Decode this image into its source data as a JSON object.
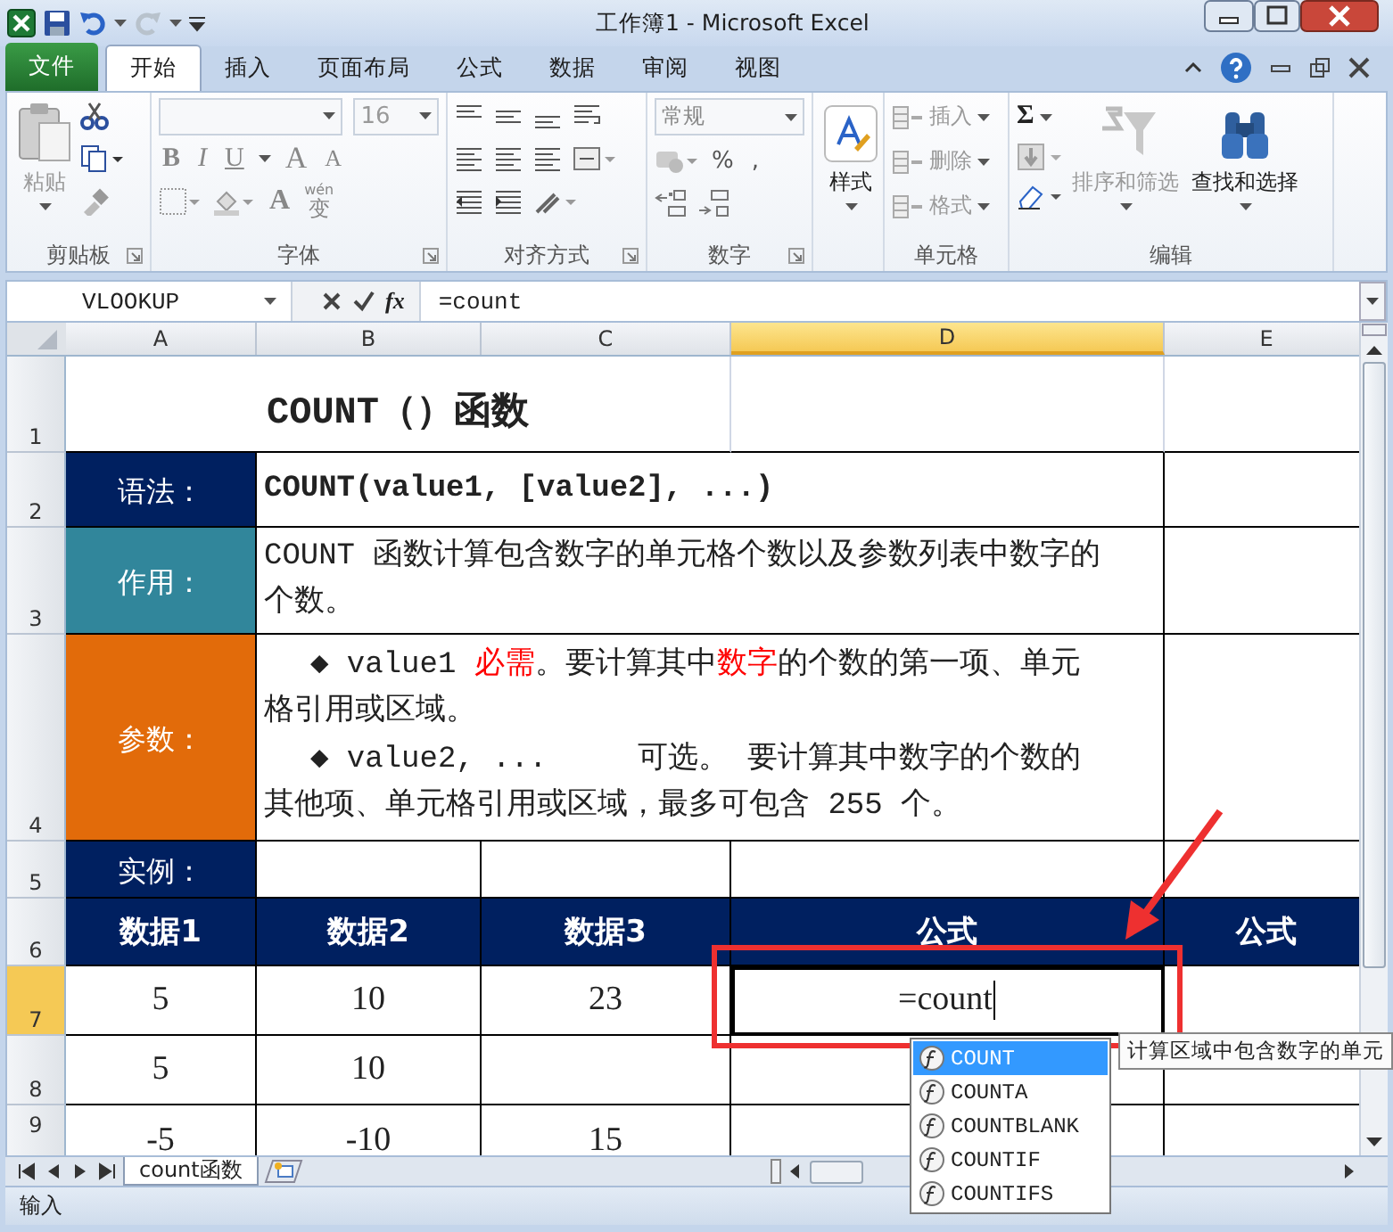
{
  "window": {
    "title": "工作簿1 - Microsoft Excel"
  },
  "ribbon_tabs": [
    {
      "label": "文件",
      "kind": "file",
      "selected": false
    },
    {
      "label": "开始",
      "kind": "tab",
      "selected": true
    },
    {
      "label": "插入",
      "kind": "tab",
      "selected": false
    },
    {
      "label": "页面布局",
      "kind": "tab",
      "selected": false
    },
    {
      "label": "公式",
      "kind": "tab",
      "selected": false
    },
    {
      "label": "数据",
      "kind": "tab",
      "selected": false
    },
    {
      "label": "审阅",
      "kind": "tab",
      "selected": false
    },
    {
      "label": "视图",
      "kind": "tab",
      "selected": false
    }
  ],
  "ribbon_groups": [
    {
      "kind": "clipboard",
      "label": "剪贴板",
      "launcher": true,
      "paste": {
        "label": "粘贴",
        "disabled": true
      }
    },
    {
      "kind": "font",
      "label": "字体",
      "launcher": true,
      "font_size": "16",
      "style_buttons": [
        "B",
        "I",
        "U"
      ],
      "size_buttons": [
        "A",
        "A"
      ],
      "font_color": "A",
      "phonetic": {
        "top": "wén",
        "main": "变"
      }
    },
    {
      "kind": "alignment",
      "label": "对齐方式",
      "launcher": true
    },
    {
      "kind": "number",
      "label": "数字",
      "launcher": true,
      "format": "常规",
      "symbols": [
        "%",
        ","
      ]
    },
    {
      "kind": "styles",
      "launcher": false,
      "button": "样式"
    },
    {
      "kind": "cells",
      "label": "单元格",
      "launcher": false,
      "buttons": [
        {
          "label": "插入",
          "disabled": true
        },
        {
          "label": "删除",
          "disabled": true
        },
        {
          "label": "格式",
          "disabled": true
        }
      ]
    },
    {
      "kind": "editing",
      "label": "编辑",
      "launcher": false,
      "sum": "Σ",
      "buttons": [
        {
          "label": "排序和筛选",
          "disabled": true
        },
        {
          "label": "查找和选择",
          "disabled": false
        }
      ]
    }
  ],
  "formula_bar": {
    "name_box": "VLOOKUP",
    "function_button": "fx",
    "value": "=count"
  },
  "columns": [
    {
      "label": "A",
      "selected": false
    },
    {
      "label": "B",
      "selected": false
    },
    {
      "label": "C",
      "selected": false
    },
    {
      "label": "D",
      "selected": true
    },
    {
      "label": "E",
      "selected": false
    }
  ],
  "rows": [
    {
      "header": "1",
      "selected": false,
      "cells": [
        {
          "kind": "title",
          "text": "COUNT（）函数"
        },
        {
          "kind": "plain",
          "text": ""
        },
        {
          "kind": "plain",
          "text": ""
        }
      ]
    },
    {
      "header": "2",
      "selected": false,
      "cells": [
        {
          "kind": "label",
          "text": "语法：",
          "color": "#002060"
        },
        {
          "kind": "body",
          "text": "COUNT(value1, [value2], ...)",
          "bold": true
        },
        {
          "kind": "plain",
          "text": ""
        }
      ]
    },
    {
      "header": "3",
      "selected": false,
      "cells": [
        {
          "kind": "label",
          "text": "作用：",
          "color": "#31869b"
        },
        {
          "kind": "body",
          "text": "COUNT 函数计算包含数字的单元格个数以及参数列表中数字的个数。",
          "bold": false
        },
        {
          "kind": "plain",
          "text": ""
        }
      ]
    },
    {
      "header": "4",
      "selected": false,
      "cells": [
        {
          "kind": "label",
          "text": "参数：",
          "color": "#e26b0a"
        },
        {
          "kind": "notes",
          "paragraphs": [
            [
              {
                "text": "◆ value1 ",
                "emphasis": false
              },
              {
                "text": "必需",
                "emphasis": true
              },
              {
                "text": "。要计算其中",
                "emphasis": false
              },
              {
                "text": "数字",
                "emphasis": true
              },
              {
                "text": "的个数的第一项、单元格引用或区域。",
                "emphasis": false
              }
            ],
            [
              {
                "text": "◆ value2, ...     可选。 要计算其中数字的个数的其他项、单元格引用或区域，最多可包含 255 个。",
                "emphasis": false
              }
            ]
          ]
        },
        {
          "kind": "plain",
          "text": ""
        }
      ]
    },
    {
      "header": "5",
      "selected": false,
      "cells": [
        {
          "kind": "label",
          "text": "实例：",
          "color": "#002060"
        },
        {
          "kind": "plain",
          "text": ""
        },
        {
          "kind": "plain",
          "text": ""
        },
        {
          "kind": "plain",
          "text": ""
        },
        {
          "kind": "plain",
          "text": ""
        }
      ]
    },
    {
      "header": "6",
      "selected": false,
      "cells": [
        {
          "kind": "header",
          "text": "数据1"
        },
        {
          "kind": "header",
          "text": "数据2"
        },
        {
          "kind": "header",
          "text": "数据3"
        },
        {
          "kind": "header",
          "text": "公式"
        },
        {
          "kind": "header",
          "text": "公式"
        }
      ]
    },
    {
      "header": "7",
      "selected": true,
      "cells": [
        {
          "kind": "data",
          "text": "5"
        },
        {
          "kind": "data",
          "text": "10"
        },
        {
          "kind": "data",
          "text": "23"
        },
        {
          "kind": "editing",
          "text": "=count"
        },
        {
          "kind": "plain",
          "text": ""
        }
      ]
    },
    {
      "header": "8",
      "selected": false,
      "cells": [
        {
          "kind": "data",
          "text": "5"
        },
        {
          "kind": "data",
          "text": "10"
        },
        {
          "kind": "data",
          "text": ""
        },
        {
          "kind": "plain",
          "text": ""
        },
        {
          "kind": "plain",
          "text": ""
        }
      ]
    },
    {
      "header": "9",
      "selected": false,
      "cells": [
        {
          "kind": "data",
          "text": "-5"
        },
        {
          "kind": "data",
          "text": "-10"
        },
        {
          "kind": "data",
          "text": "15"
        },
        {
          "kind": "plain",
          "text": ""
        },
        {
          "kind": "plain",
          "text": ""
        }
      ]
    }
  ],
  "autocomplete": [
    {
      "label": "COUNT",
      "selected": true
    },
    {
      "label": "COUNTA",
      "selected": false
    },
    {
      "label": "COUNTBLANK",
      "selected": false
    },
    {
      "label": "COUNTIF",
      "selected": false
    },
    {
      "label": "COUNTIFS",
      "selected": false
    }
  ],
  "tooltip": "计算区域中包含数字的单元",
  "sheet_tabs": [
    {
      "label": "count函数",
      "selected": true
    }
  ],
  "status_bar": {
    "mode": "输入"
  }
}
